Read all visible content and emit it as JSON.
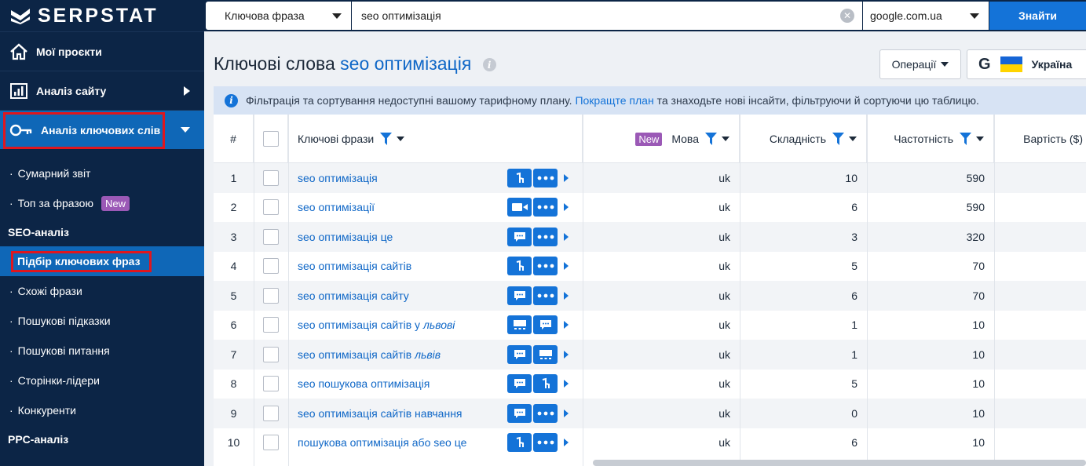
{
  "brand": {
    "name": "SERPSTAT"
  },
  "search": {
    "type_label": "Ключова фраза",
    "query": "seo оптимізація",
    "database": "google.com.ua",
    "button": "Знайти"
  },
  "sidebar": {
    "items": [
      {
        "label": "Мої проєкти"
      },
      {
        "label": "Аналіз сайту"
      },
      {
        "label": "Аналіз ключових слів"
      }
    ],
    "sub_items": {
      "summary": "Сумарний звіт",
      "top": "Топ за фразою",
      "new_badge": "New",
      "seo_header": "SEO-аналіз",
      "selection": "Підбір ключових фраз",
      "similar": "Схожі фрази",
      "suggestions": "Пошукові підказки",
      "questions": "Пошукові питання",
      "leaders": "Сторінки-лідери",
      "competitors": "Конкуренти",
      "ppc_header": "PPC-аналіз"
    }
  },
  "header": {
    "title_prefix": "Ключові слова",
    "title_keyword": "seo оптимізація",
    "operations": "Операції",
    "region": "Україна"
  },
  "notice": {
    "before": "Фільтрація та сортування недоступні вашому тарифному плану.",
    "link": "Покращте план",
    "after": "та знаходьте нові інсайти, фільтруючи й сортуючи цю таблицю."
  },
  "table": {
    "columns": {
      "num": "#",
      "keyword": "Ключові фрази",
      "new_badge": "New",
      "lang": "Мова",
      "difficulty": "Складність",
      "volume": "Частотність",
      "cost": "Вартість ($)"
    },
    "rows": [
      {
        "num": "1",
        "kw": "seo оптимізація",
        "kw_em": "",
        "lang": "uk",
        "diff": "10",
        "vol": "590",
        "icons": [
          "nav",
          "dots"
        ]
      },
      {
        "num": "2",
        "kw": "seo оптимізації",
        "kw_em": "",
        "lang": "uk",
        "diff": "6",
        "vol": "590",
        "icons": [
          "video",
          "dots"
        ]
      },
      {
        "num": "3",
        "kw": "seo оптимізація це",
        "kw_em": "",
        "lang": "uk",
        "diff": "3",
        "vol": "320",
        "icons": [
          "chat",
          "dots"
        ]
      },
      {
        "num": "4",
        "kw": "seo оптимізація сайтів",
        "kw_em": "",
        "lang": "uk",
        "diff": "5",
        "vol": "70",
        "icons": [
          "nav",
          "dots"
        ]
      },
      {
        "num": "5",
        "kw": "seo оптимізація сайту",
        "kw_em": "",
        "lang": "uk",
        "diff": "6",
        "vol": "70",
        "icons": [
          "chat",
          "dots"
        ]
      },
      {
        "num": "6",
        "kw": "seo оптимізація сайтів у ",
        "kw_em": "львові",
        "lang": "uk",
        "diff": "1",
        "vol": "10",
        "icons": [
          "ads",
          "chat"
        ]
      },
      {
        "num": "7",
        "kw": "seo оптимізація сайтів ",
        "kw_em": "львів",
        "lang": "uk",
        "diff": "1",
        "vol": "10",
        "icons": [
          "chat",
          "ads"
        ]
      },
      {
        "num": "8",
        "kw": "seo пошукова оптимізація",
        "kw_em": "",
        "lang": "uk",
        "diff": "5",
        "vol": "10",
        "icons": [
          "chat",
          "nav"
        ]
      },
      {
        "num": "9",
        "kw": "seo оптимізація сайтів навчання",
        "kw_em": "",
        "lang": "uk",
        "diff": "0",
        "vol": "10",
        "icons": [
          "chat",
          "dots"
        ]
      },
      {
        "num": "10",
        "kw": "пошукова оптимізація або seo це",
        "kw_em": "",
        "lang": "uk",
        "diff": "6",
        "vol": "10",
        "icons": [
          "nav",
          "dots"
        ]
      }
    ]
  },
  "colors": {
    "sidebar": "#0c2546",
    "accent": "#1473d8",
    "highlight": "#e0161e",
    "badge": "#9b59b6"
  }
}
